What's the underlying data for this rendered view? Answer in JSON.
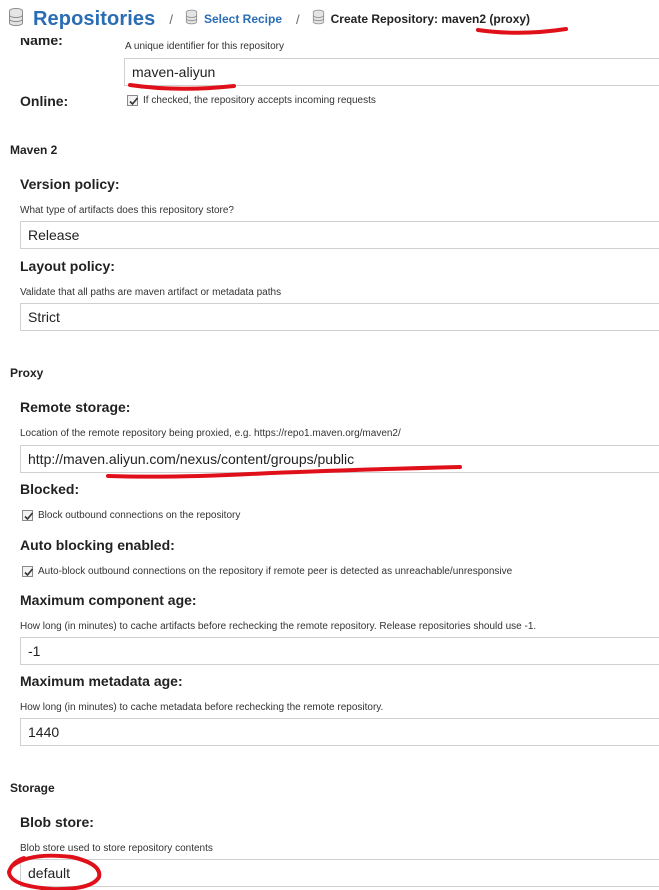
{
  "breadcrumb": {
    "root": "Repositories",
    "separator": "/",
    "recipe": "Select Recipe",
    "current_prefix": "Create Repository: ",
    "current_value": "maven2 (proxy)"
  },
  "name_field": {
    "label": "Name:",
    "help": "A unique identifier for this repository",
    "value": "maven-aliyun"
  },
  "online": {
    "label": "Online:",
    "checked": true,
    "text": "If checked, the repository accepts incoming requests"
  },
  "maven2": {
    "section_title": "Maven 2",
    "version_policy": {
      "label": "Version policy:",
      "help": "What type of artifacts does this repository store?",
      "value": "Release"
    },
    "layout_policy": {
      "label": "Layout policy:",
      "help": "Validate that all paths are maven artifact or metadata paths",
      "value": "Strict"
    }
  },
  "proxy": {
    "section_title": "Proxy",
    "remote_storage": {
      "label": "Remote storage:",
      "help": "Location of the remote repository being proxied, e.g. https://repo1.maven.org/maven2/",
      "value": "http://maven.aliyun.com/nexus/content/groups/public"
    },
    "blocked": {
      "label": "Blocked:",
      "checked": true,
      "text": "Block outbound connections on the repository"
    },
    "auto_blocking": {
      "label": "Auto blocking enabled:",
      "checked": true,
      "text": "Auto-block outbound connections on the repository if remote peer is detected as unreachable/unresponsive"
    },
    "max_component_age": {
      "label": "Maximum component age:",
      "help": "How long (in minutes) to cache artifacts before rechecking the remote repository. Release repositories should use -1.",
      "value": "-1"
    },
    "max_metadata_age": {
      "label": "Maximum metadata age:",
      "help": "How long (in minutes) to cache metadata before rechecking the remote repository.",
      "value": "1440"
    }
  },
  "storage": {
    "section_title": "Storage",
    "blob_store": {
      "label": "Blob store:",
      "help": "Blob store used to store repository contents",
      "value": "default"
    }
  },
  "colors": {
    "link": "#2a6db5",
    "annotation_red": "#e0101a",
    "input_border": "#d0d0d0"
  }
}
